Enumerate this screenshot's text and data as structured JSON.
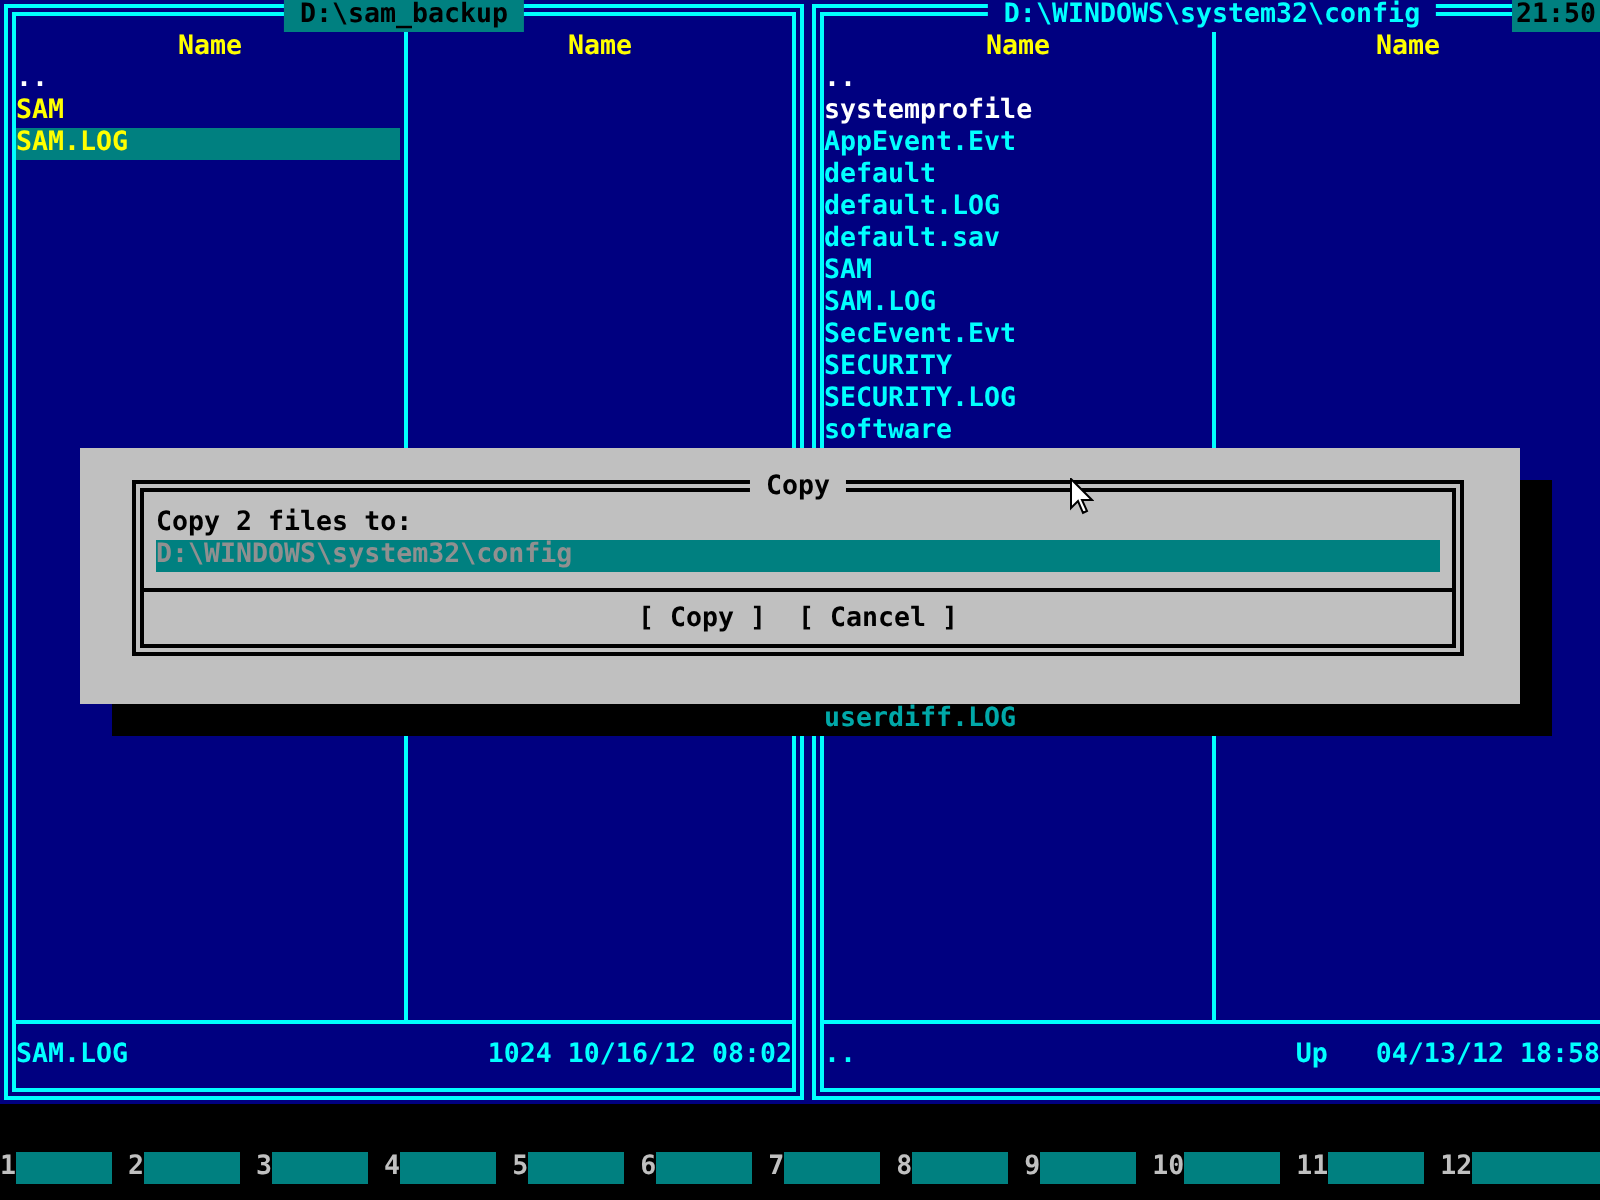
{
  "clock": "21:50",
  "left_panel": {
    "title": "D:\\sam_backup",
    "active": true,
    "column_headers": [
      "Name",
      "Name"
    ],
    "files": [
      {
        "name": "..",
        "kind": "up",
        "marked": false,
        "selected": false
      },
      {
        "name": "SAM",
        "kind": "file",
        "marked": true,
        "selected": false
      },
      {
        "name": "SAM.LOG",
        "kind": "file",
        "marked": true,
        "selected": true
      }
    ],
    "status": {
      "name": "SAM.LOG",
      "info": "1024 10/16/12 08:02"
    }
  },
  "right_panel": {
    "title": "D:\\WINDOWS\\system32\\config",
    "active": false,
    "column_headers": [
      "Name",
      "Name"
    ],
    "files": [
      {
        "name": "..",
        "kind": "up",
        "marked": false,
        "selected": false
      },
      {
        "name": "systemprofile",
        "kind": "folder",
        "marked": false,
        "selected": false
      },
      {
        "name": "AppEvent.Evt",
        "kind": "file",
        "marked": false,
        "selected": false
      },
      {
        "name": "default",
        "kind": "file",
        "marked": false,
        "selected": false
      },
      {
        "name": "default.LOG",
        "kind": "file",
        "marked": false,
        "selected": false
      },
      {
        "name": "default.sav",
        "kind": "file",
        "marked": false,
        "selected": false
      },
      {
        "name": "SAM",
        "kind": "file",
        "marked": false,
        "selected": false
      },
      {
        "name": "SAM.LOG",
        "kind": "file",
        "marked": false,
        "selected": false
      },
      {
        "name": "SecEvent.Evt",
        "kind": "file",
        "marked": false,
        "selected": false
      },
      {
        "name": "SECURITY",
        "kind": "file",
        "marked": false,
        "selected": false
      },
      {
        "name": "SECURITY.LOG",
        "kind": "file",
        "marked": false,
        "selected": false
      },
      {
        "name": "software",
        "kind": "file",
        "marked": false,
        "selected": false
      }
    ],
    "files_below_dialog": [
      {
        "name": "userdiff.LOG"
      }
    ],
    "status": {
      "name": "..",
      "info": "Up   04/13/12 18:58"
    }
  },
  "dialog": {
    "title": "Copy",
    "prompt": "Copy 2 files to:",
    "value": "D:\\WINDOWS\\system32\\config",
    "buttons": [
      "[ Copy ]",
      "[ Cancel ]"
    ]
  },
  "keybar": [
    {
      "number": "1"
    },
    {
      "number": "2"
    },
    {
      "number": "3"
    },
    {
      "number": "4"
    },
    {
      "number": "5"
    },
    {
      "number": "6"
    },
    {
      "number": "7"
    },
    {
      "number": "8"
    },
    {
      "number": "9"
    },
    {
      "number": "10"
    },
    {
      "number": "11"
    },
    {
      "number": "12"
    }
  ]
}
